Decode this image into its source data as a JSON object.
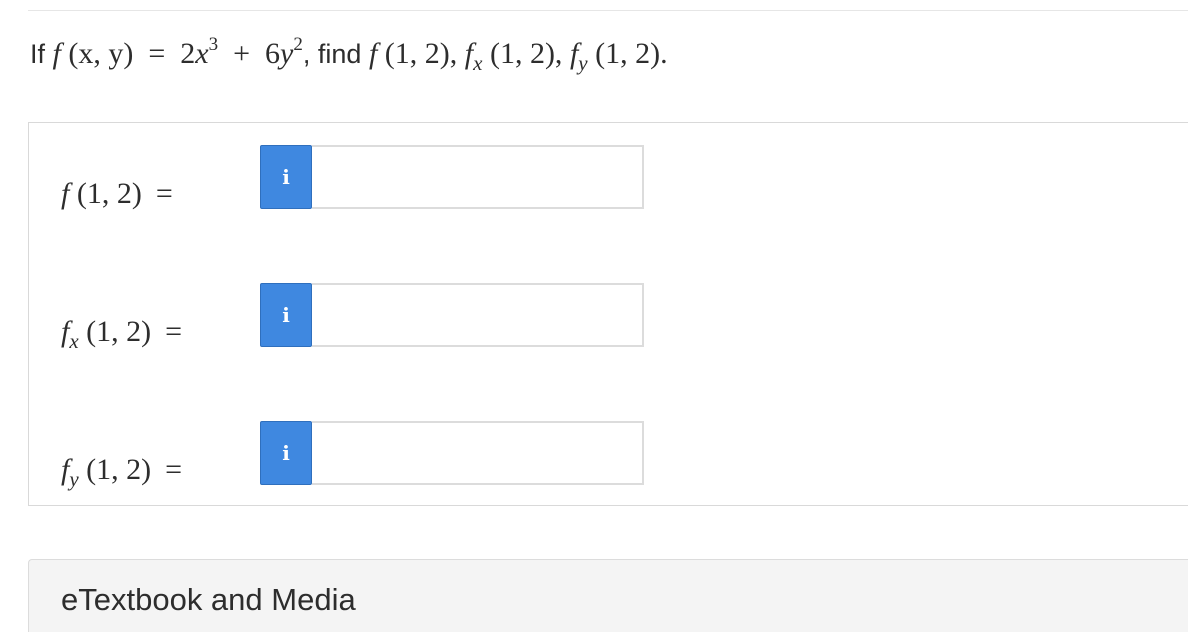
{
  "question": {
    "prefix": "If",
    "f": "f",
    "args": "(x, y)",
    "equals": "=",
    "coef1": "2",
    "var1": "x",
    "exp1": "3",
    "plus": "+",
    "coef2": "6",
    "var2": "y",
    "exp2": "2",
    "comma1": ",",
    "find": "find",
    "t1": "(1, 2),",
    "sub_x": "x",
    "t2": "(1, 2),",
    "sub_y": "y",
    "t3": "(1, 2)."
  },
  "rows": [
    {
      "f": "f",
      "sub": "",
      "args": "(1, 2)",
      "eq": "=",
      "info": "i",
      "value": ""
    },
    {
      "f": "f",
      "sub": "x",
      "args": "(1, 2)",
      "eq": "=",
      "info": "i",
      "value": ""
    },
    {
      "f": "f",
      "sub": "y",
      "args": "(1, 2)",
      "eq": "=",
      "info": "i",
      "value": ""
    }
  ],
  "media": {
    "title": "eTextbook and Media"
  },
  "colors": {
    "info_button": "#3f88e0",
    "panel_background": "#f4f4f4"
  }
}
